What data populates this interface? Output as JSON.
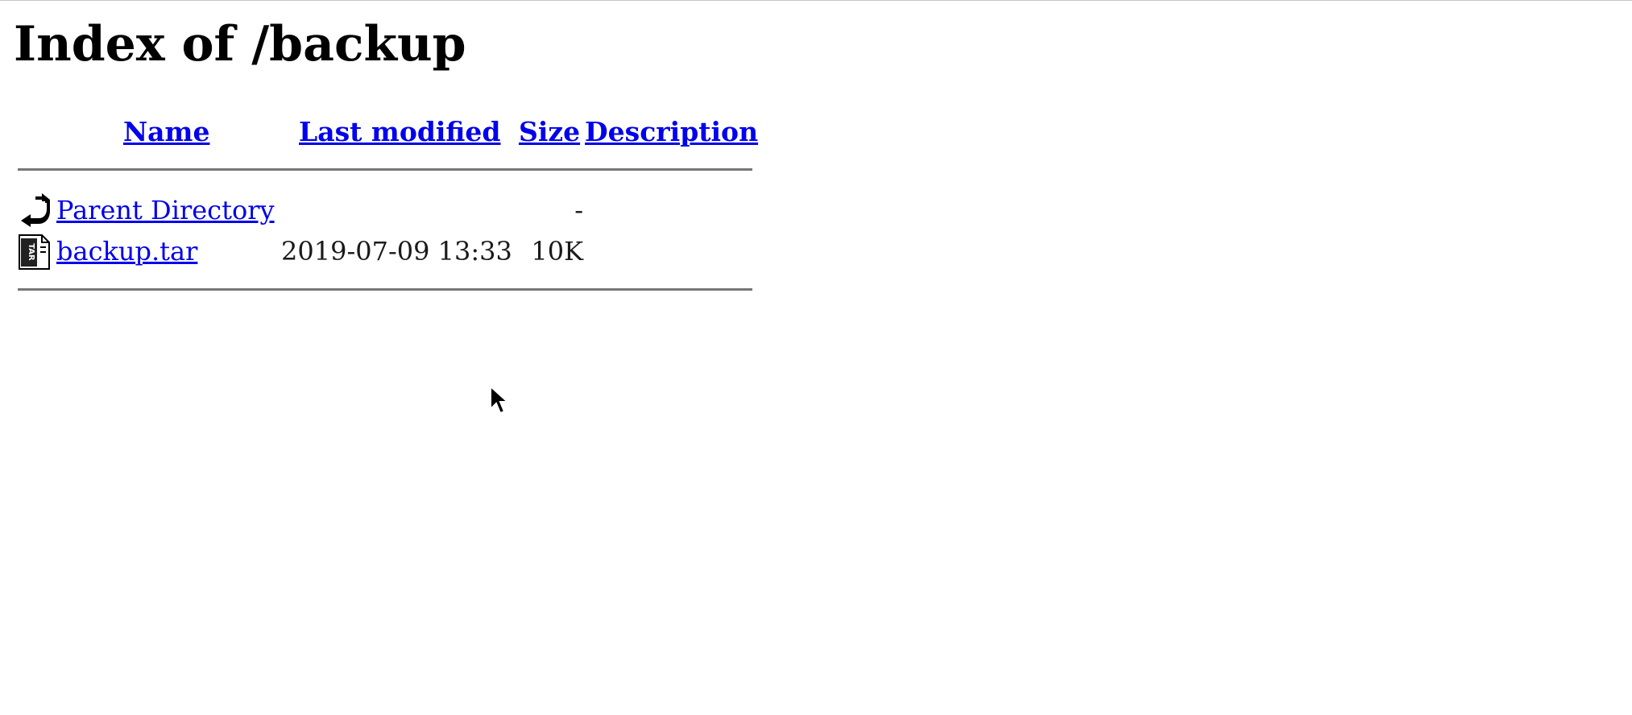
{
  "page": {
    "title": "Index of /backup"
  },
  "table": {
    "headers": {
      "name": "Name",
      "last_modified": "Last modified",
      "size": "Size",
      "description": "Description"
    },
    "rows": [
      {
        "icon": "back-arrow-icon",
        "name": "Parent Directory",
        "last_modified": "",
        "size": "-",
        "description": ""
      },
      {
        "icon": "tar-file-icon",
        "name": "backup.tar",
        "last_modified": "2019-07-09 13:33",
        "size": "10K",
        "description": ""
      }
    ]
  },
  "colors": {
    "link": "#0000ee",
    "text": "#1a1a1a",
    "rule": "#777777"
  }
}
